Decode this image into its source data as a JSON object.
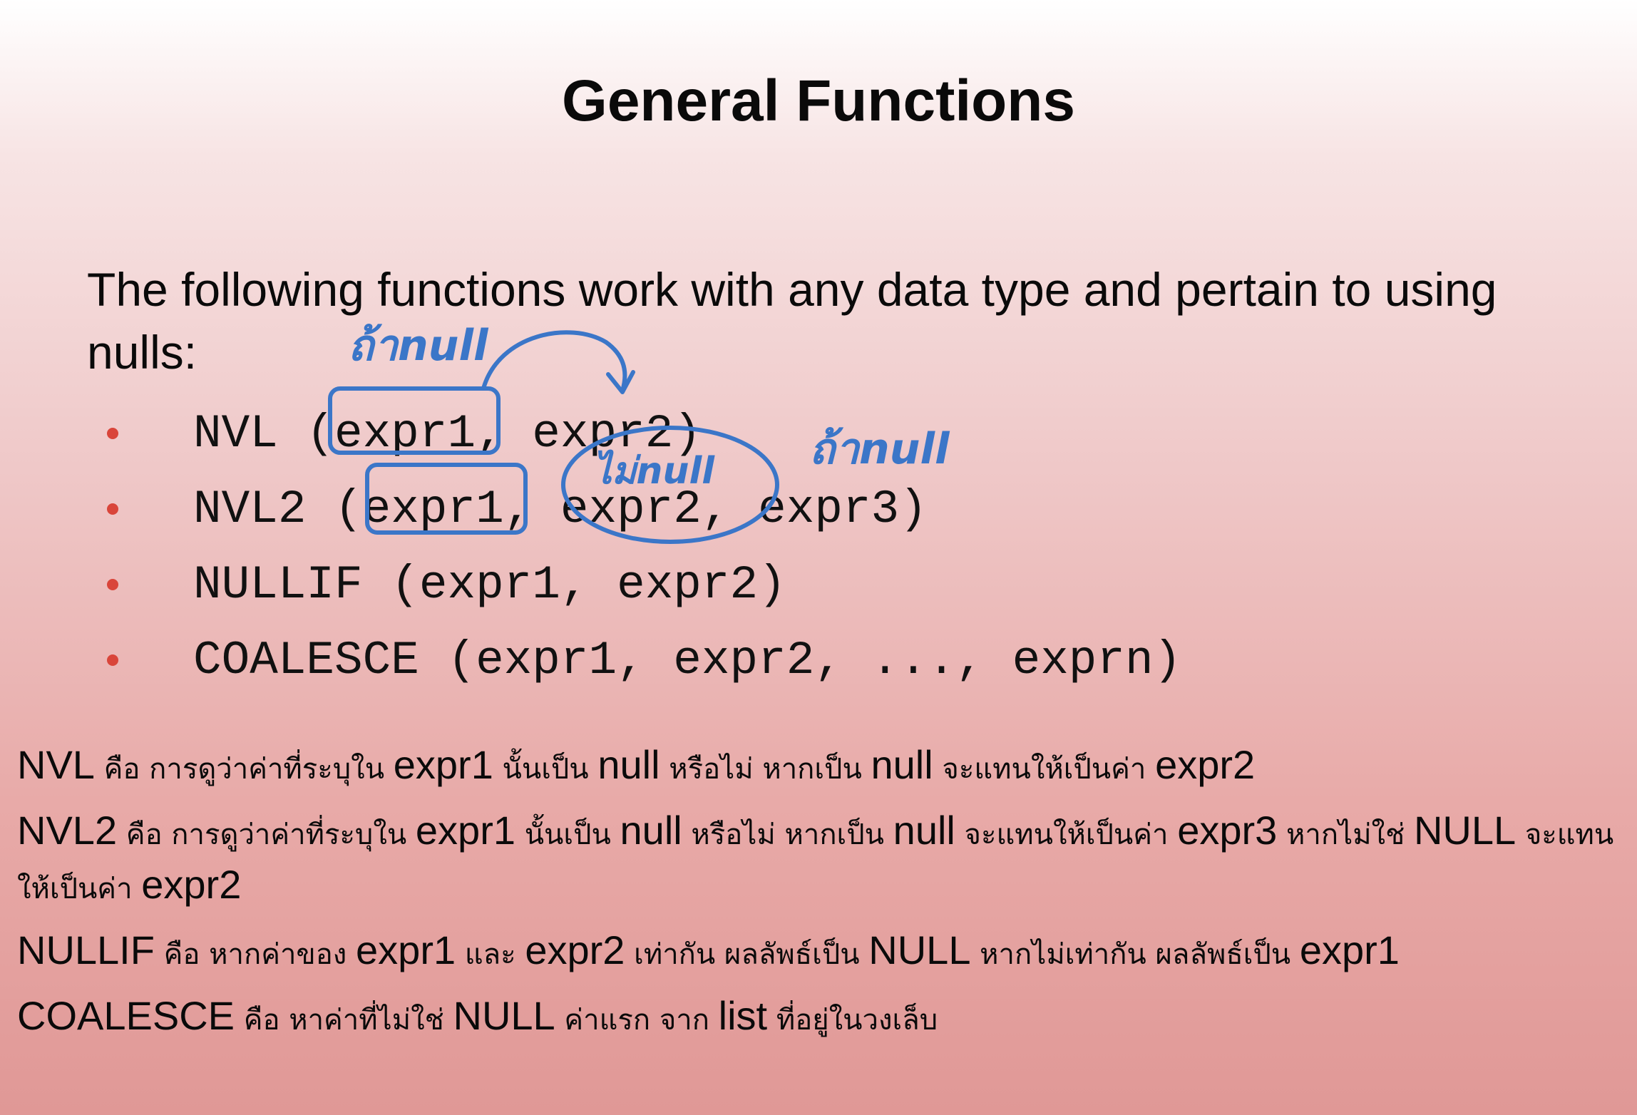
{
  "title": "General Functions",
  "intro": "The following functions work with any data type and pertain to using nulls:",
  "bullets": [
    "NVL (expr1, expr2)",
    "NVL2 (expr1, expr2, expr3)",
    "NULLIF (expr1, expr2)",
    "COALESCE (expr1, expr2, ..., exprn)"
  ],
  "notes": [
    [
      {
        "text": "NVL",
        "thai": false
      },
      {
        "text": " คือ การดูว่าค่าที่ระบุใน ",
        "thai": true
      },
      {
        "text": "expr1",
        "thai": false
      },
      {
        "text": " นั้นเป็น ",
        "thai": true
      },
      {
        "text": "null",
        "thai": false
      },
      {
        "text": " หรือไม่ หากเป็น ",
        "thai": true
      },
      {
        "text": "null",
        "thai": false
      },
      {
        "text": " จะแทนให้เป็นค่า ",
        "thai": true
      },
      {
        "text": "expr2",
        "thai": false
      }
    ],
    [
      {
        "text": "NVL2",
        "thai": false
      },
      {
        "text": " คือ การดูว่าค่าที่ระบุใน ",
        "thai": true
      },
      {
        "text": "expr1",
        "thai": false
      },
      {
        "text": " นั้นเป็น ",
        "thai": true
      },
      {
        "text": "null",
        "thai": false
      },
      {
        "text": " หรือไม่ หากเป็น ",
        "thai": true
      },
      {
        "text": "null",
        "thai": false
      },
      {
        "text": " จะแทนให้เป็นค่า ",
        "thai": true
      },
      {
        "text": "expr3",
        "thai": false
      },
      {
        "text": " หากไม่ใช่ ",
        "thai": true
      },
      {
        "text": "NULL",
        "thai": false
      },
      {
        "text": " จะแทนให้เป็นค่า ",
        "thai": true
      },
      {
        "text": "expr2",
        "thai": false
      }
    ],
    [
      {
        "text": "NULLIF",
        "thai": false
      },
      {
        "text": " คือ หากค่าของ ",
        "thai": true
      },
      {
        "text": "expr1",
        "thai": false
      },
      {
        "text": " และ ",
        "thai": true
      },
      {
        "text": "expr2",
        "thai": false
      },
      {
        "text": " เท่ากัน ผลลัพธ์เป็น ",
        "thai": true
      },
      {
        "text": "NULL",
        "thai": false
      },
      {
        "text": " หากไม่เท่ากัน ผลลัพธ์เป็น ",
        "thai": true
      },
      {
        "text": "expr1",
        "thai": false
      }
    ],
    [
      {
        "text": "COALESCE",
        "thai": false
      },
      {
        "text": " คือ หาค่าที่ไม่ใช่ ",
        "thai": true
      },
      {
        "text": "NULL",
        "thai": false
      },
      {
        "text": " ค่าแรก จาก ",
        "thai": true
      },
      {
        "text": "list",
        "thai": false
      },
      {
        "text": " ที่อยู่ในวงเล็บ",
        "thai": true
      }
    ]
  ],
  "annotations": {
    "note_if_null": "ถ้าnull",
    "note_not_null": "ไม่null",
    "note_is_null": "ถ้าnull"
  },
  "colors": {
    "ink": "#3b76c8",
    "bullet": "#d9453a",
    "text": "#0a0a0a"
  }
}
